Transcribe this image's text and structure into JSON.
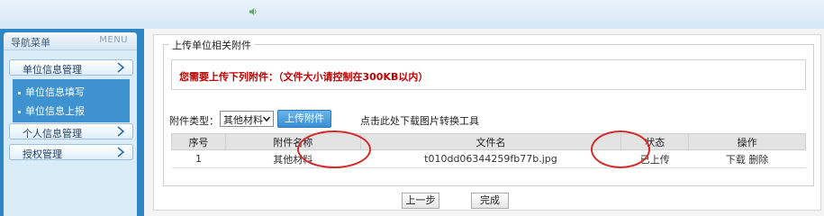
{
  "topbar": {
    "icon": "speaker-icon"
  },
  "sidebar": {
    "title": "导航菜单",
    "menu_label": "MENU",
    "groups": [
      {
        "label": "单位信息管理",
        "icon": "chevron-right-icon"
      },
      {
        "label": "个人信息管理",
        "icon": "chevron-right-icon"
      },
      {
        "label": "授权管理",
        "icon": "chevron-right-icon"
      }
    ],
    "subitems": [
      {
        "label": "单位信息填写"
      },
      {
        "label": "单位信息上报"
      }
    ]
  },
  "main": {
    "legend": "上传单位相关附件",
    "notice": "您需要上传下列附件：（文件大小请控制在300KB以内）",
    "type_label": "附件类型：",
    "type_select": {
      "value": "其他材料"
    },
    "upload_button": "上传附件",
    "tool_link": "点击此处下载图片转换工具",
    "table": {
      "headers": [
        "序号",
        "附件名称",
        "文件名",
        "状态",
        "操作"
      ],
      "rows": [
        {
          "index": "1",
          "name": "其他材料",
          "file": "t010dd06344259fb77b.jpg",
          "status": "已上传",
          "download": "下载",
          "delete": "删除"
        }
      ]
    },
    "prev_button": "上一步",
    "finish_button": "完成"
  },
  "colors": {
    "sidebar_blue": "#2f86c4",
    "annotation_red": "#d42a2a",
    "notice_red": "#c00000",
    "upload_blue": "#3a8fd1"
  }
}
